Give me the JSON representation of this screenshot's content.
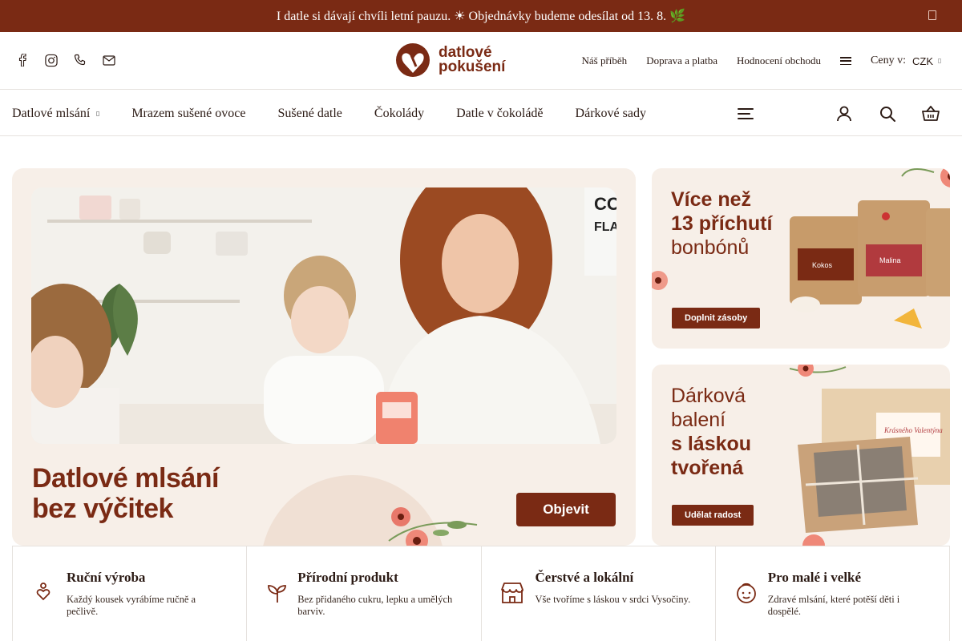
{
  "announcement": {
    "text": "I datle si dávají chvíli letní pauzu. ☀ Objednávky budeme odesílat od 13. 8. 🌿"
  },
  "header": {
    "social": [
      "facebook-icon",
      "instagram-icon",
      "phone-icon",
      "mail-icon"
    ],
    "logo_line1": "datlové",
    "logo_line2": "pokušení",
    "links": [
      "Náš příběh",
      "Doprava a platba",
      "Hodnocení obchodu"
    ],
    "currency_label": "Ceny v:",
    "currency_value": "CZK"
  },
  "nav": {
    "items": [
      "Datlové mlsání",
      "Mrazem sušené ovoce",
      "Sušené datle",
      "Čokolády",
      "Datle v čokoládě",
      "Dárkové sady"
    ]
  },
  "hero": {
    "title_line1": "Datlové mlsání",
    "title_line2": "bez výčitek",
    "cta": "Objevit"
  },
  "banner1": {
    "line1": "Více než",
    "line2": "13 příchutí",
    "line3": "bonbónů",
    "cta": "Doplnit zásoby",
    "bag_label1": "Kokos",
    "bag_label2": "Malina"
  },
  "banner2": {
    "line1": "Dárková",
    "line2": "balení",
    "line3": "s láskou",
    "line4": "tvořená",
    "cta": "Udělat radost",
    "tag_text": "Krásného Valentýna"
  },
  "features": [
    {
      "title": "Ruční výroba",
      "desc": "Každý kousek vyrábíme ručně a pečlivě.",
      "icon": "hand-heart-icon"
    },
    {
      "title": "Přírodní produkt",
      "desc": "Bez přidaného cukru, lepku a umělých barviv.",
      "icon": "sprout-icon"
    },
    {
      "title": "Čerstvé a lokální",
      "desc": "Vše tvoříme s láskou v srdci Vysočiny.",
      "icon": "store-icon"
    },
    {
      "title": "Pro malé i velké",
      "desc": "Zdravé mlsání, které potěší děti i dospělé.",
      "icon": "child-face-icon"
    }
  ],
  "colors": {
    "brand": "#7a2a14",
    "cream": "#f7efe8"
  }
}
